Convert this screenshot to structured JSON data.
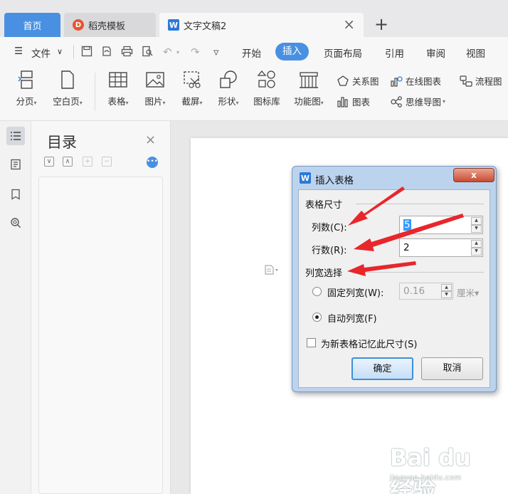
{
  "tabs": {
    "home": "首页",
    "template": "稻壳模板",
    "document": "文字文稿2",
    "close_glyph": "×",
    "add_glyph": "+"
  },
  "menu": {
    "hamburger": "☰",
    "file": "文件",
    "file_chevron": "∨",
    "more": "▿",
    "items": [
      "开始",
      "插入",
      "页面布局",
      "引用",
      "审阅",
      "视图"
    ],
    "active_index": 1
  },
  "ribbon": {
    "page_break": "分页",
    "blank_page": "空白页",
    "table": "表格",
    "picture": "图片",
    "screenshot": "截屏",
    "shape": "形状",
    "icon_library": "图标库",
    "function_chart": "功能图",
    "relation_chart": "关系图",
    "online_chart": "在线图表",
    "flowchart": "流程图",
    "chart": "图表",
    "mind_map": "思维导图",
    "dropdown_glyph": "▾"
  },
  "toc": {
    "title": "目录",
    "close_glyph": "×",
    "tool_glyphs": [
      "∨",
      "∧",
      "+",
      "−"
    ]
  },
  "dialog": {
    "title": "插入表格",
    "close_glyph": "x",
    "size_group": "表格尺寸",
    "columns_label": "列数(C):",
    "columns_value": "5",
    "rows_label": "行数(R):",
    "rows_value": "2",
    "width_group": "列宽选择",
    "fixed_width_label": "固定列宽(W):",
    "fixed_width_value": "0.16",
    "unit": "厘米▾",
    "auto_width_label": "自动列宽(F)",
    "remember_label": "为新表格记忆此尺寸(S)",
    "ok_label": "确定",
    "cancel_label": "取消",
    "selected_width_mode": "auto",
    "remember_checked": false
  },
  "watermark": {
    "main": "Bai du 经验",
    "sub": "jingyan.baidu.com"
  },
  "colors": {
    "accent": "#4a90e2",
    "arrow": "#e8262c",
    "dialog_frame": "#bcd3ee"
  }
}
